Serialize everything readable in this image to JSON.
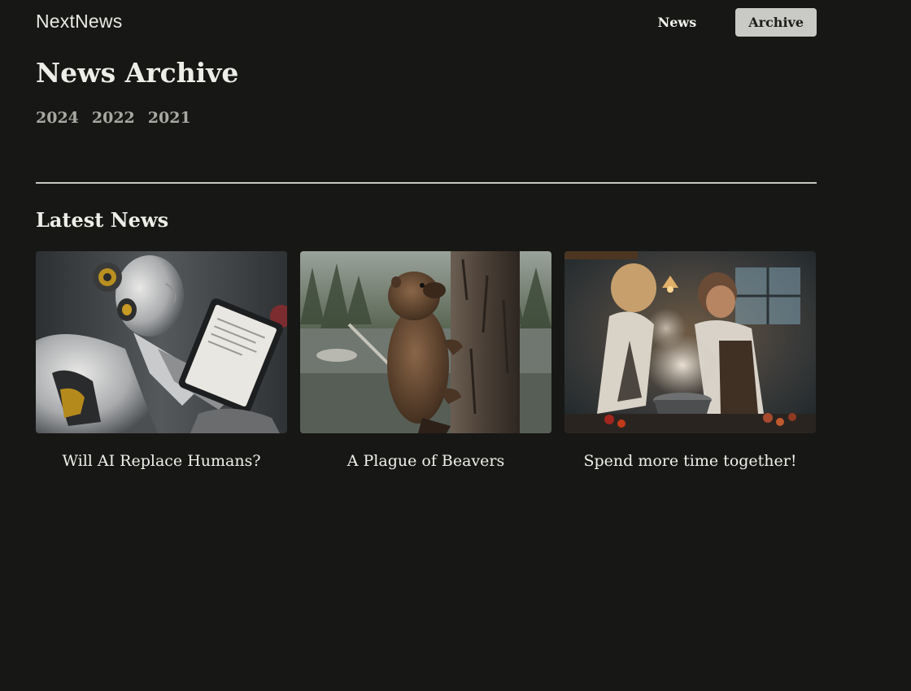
{
  "header": {
    "logo": "NextNews",
    "nav": [
      {
        "label": "News"
      },
      {
        "label": "Archive"
      }
    ]
  },
  "archive": {
    "title": "News Archive",
    "years": [
      "2024",
      "2022",
      "2021"
    ]
  },
  "latest": {
    "title": "Latest News",
    "cards": [
      {
        "title": "Will AI Replace Humans?",
        "image": "robot-with-tablet-image"
      },
      {
        "title": "A Plague of Beavers",
        "image": "beaver-climbing-tree-image"
      },
      {
        "title": "Spend more time together!",
        "image": "couple-cooking-image"
      }
    ]
  }
}
